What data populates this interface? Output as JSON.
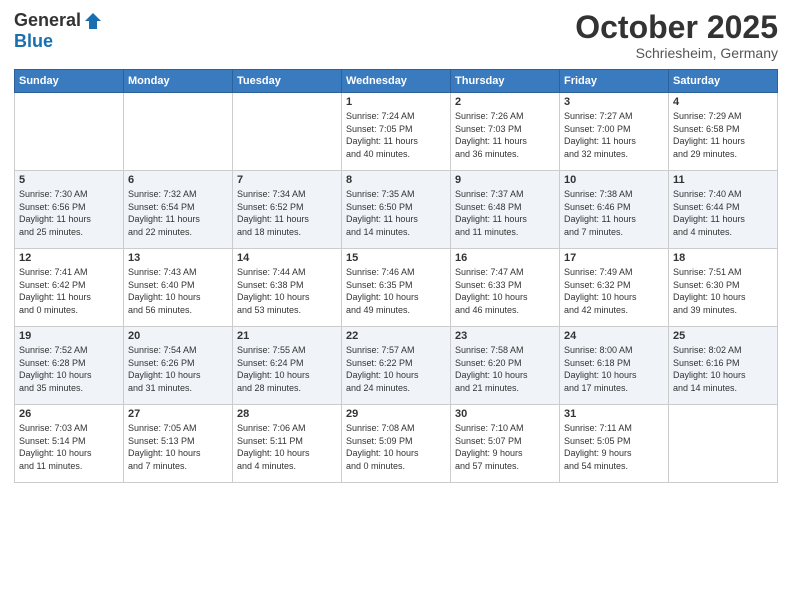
{
  "logo": {
    "general": "General",
    "blue": "Blue"
  },
  "title": "October 2025",
  "location": "Schriesheim, Germany",
  "weekdays": [
    "Sunday",
    "Monday",
    "Tuesday",
    "Wednesday",
    "Thursday",
    "Friday",
    "Saturday"
  ],
  "weeks": [
    [
      {
        "day": "",
        "info": ""
      },
      {
        "day": "",
        "info": ""
      },
      {
        "day": "",
        "info": ""
      },
      {
        "day": "1",
        "info": "Sunrise: 7:24 AM\nSunset: 7:05 PM\nDaylight: 11 hours\nand 40 minutes."
      },
      {
        "day": "2",
        "info": "Sunrise: 7:26 AM\nSunset: 7:03 PM\nDaylight: 11 hours\nand 36 minutes."
      },
      {
        "day": "3",
        "info": "Sunrise: 7:27 AM\nSunset: 7:00 PM\nDaylight: 11 hours\nand 32 minutes."
      },
      {
        "day": "4",
        "info": "Sunrise: 7:29 AM\nSunset: 6:58 PM\nDaylight: 11 hours\nand 29 minutes."
      }
    ],
    [
      {
        "day": "5",
        "info": "Sunrise: 7:30 AM\nSunset: 6:56 PM\nDaylight: 11 hours\nand 25 minutes."
      },
      {
        "day": "6",
        "info": "Sunrise: 7:32 AM\nSunset: 6:54 PM\nDaylight: 11 hours\nand 22 minutes."
      },
      {
        "day": "7",
        "info": "Sunrise: 7:34 AM\nSunset: 6:52 PM\nDaylight: 11 hours\nand 18 minutes."
      },
      {
        "day": "8",
        "info": "Sunrise: 7:35 AM\nSunset: 6:50 PM\nDaylight: 11 hours\nand 14 minutes."
      },
      {
        "day": "9",
        "info": "Sunrise: 7:37 AM\nSunset: 6:48 PM\nDaylight: 11 hours\nand 11 minutes."
      },
      {
        "day": "10",
        "info": "Sunrise: 7:38 AM\nSunset: 6:46 PM\nDaylight: 11 hours\nand 7 minutes."
      },
      {
        "day": "11",
        "info": "Sunrise: 7:40 AM\nSunset: 6:44 PM\nDaylight: 11 hours\nand 4 minutes."
      }
    ],
    [
      {
        "day": "12",
        "info": "Sunrise: 7:41 AM\nSunset: 6:42 PM\nDaylight: 11 hours\nand 0 minutes."
      },
      {
        "day": "13",
        "info": "Sunrise: 7:43 AM\nSunset: 6:40 PM\nDaylight: 10 hours\nand 56 minutes."
      },
      {
        "day": "14",
        "info": "Sunrise: 7:44 AM\nSunset: 6:38 PM\nDaylight: 10 hours\nand 53 minutes."
      },
      {
        "day": "15",
        "info": "Sunrise: 7:46 AM\nSunset: 6:35 PM\nDaylight: 10 hours\nand 49 minutes."
      },
      {
        "day": "16",
        "info": "Sunrise: 7:47 AM\nSunset: 6:33 PM\nDaylight: 10 hours\nand 46 minutes."
      },
      {
        "day": "17",
        "info": "Sunrise: 7:49 AM\nSunset: 6:32 PM\nDaylight: 10 hours\nand 42 minutes."
      },
      {
        "day": "18",
        "info": "Sunrise: 7:51 AM\nSunset: 6:30 PM\nDaylight: 10 hours\nand 39 minutes."
      }
    ],
    [
      {
        "day": "19",
        "info": "Sunrise: 7:52 AM\nSunset: 6:28 PM\nDaylight: 10 hours\nand 35 minutes."
      },
      {
        "day": "20",
        "info": "Sunrise: 7:54 AM\nSunset: 6:26 PM\nDaylight: 10 hours\nand 31 minutes."
      },
      {
        "day": "21",
        "info": "Sunrise: 7:55 AM\nSunset: 6:24 PM\nDaylight: 10 hours\nand 28 minutes."
      },
      {
        "day": "22",
        "info": "Sunrise: 7:57 AM\nSunset: 6:22 PM\nDaylight: 10 hours\nand 24 minutes."
      },
      {
        "day": "23",
        "info": "Sunrise: 7:58 AM\nSunset: 6:20 PM\nDaylight: 10 hours\nand 21 minutes."
      },
      {
        "day": "24",
        "info": "Sunrise: 8:00 AM\nSunset: 6:18 PM\nDaylight: 10 hours\nand 17 minutes."
      },
      {
        "day": "25",
        "info": "Sunrise: 8:02 AM\nSunset: 6:16 PM\nDaylight: 10 hours\nand 14 minutes."
      }
    ],
    [
      {
        "day": "26",
        "info": "Sunrise: 7:03 AM\nSunset: 5:14 PM\nDaylight: 10 hours\nand 11 minutes."
      },
      {
        "day": "27",
        "info": "Sunrise: 7:05 AM\nSunset: 5:13 PM\nDaylight: 10 hours\nand 7 minutes."
      },
      {
        "day": "28",
        "info": "Sunrise: 7:06 AM\nSunset: 5:11 PM\nDaylight: 10 hours\nand 4 minutes."
      },
      {
        "day": "29",
        "info": "Sunrise: 7:08 AM\nSunset: 5:09 PM\nDaylight: 10 hours\nand 0 minutes."
      },
      {
        "day": "30",
        "info": "Sunrise: 7:10 AM\nSunset: 5:07 PM\nDaylight: 9 hours\nand 57 minutes."
      },
      {
        "day": "31",
        "info": "Sunrise: 7:11 AM\nSunset: 5:05 PM\nDaylight: 9 hours\nand 54 minutes."
      },
      {
        "day": "",
        "info": ""
      }
    ]
  ]
}
